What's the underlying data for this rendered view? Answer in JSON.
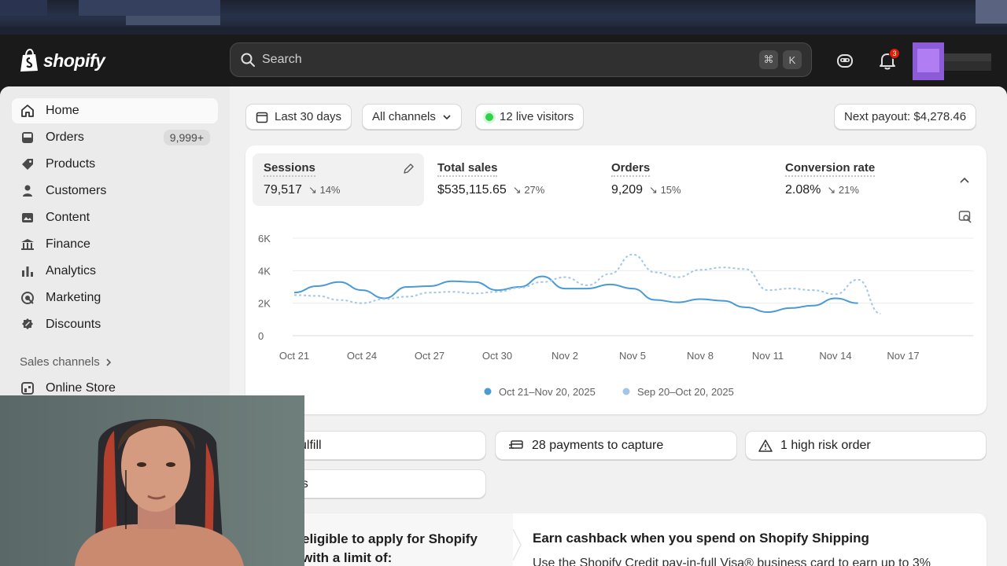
{
  "header": {
    "logo_text": "shopify",
    "search_placeholder": "Search",
    "shortcut_keys": [
      "⌘",
      "K"
    ],
    "notification_count": "3"
  },
  "sidebar": {
    "items": [
      {
        "label": "Home",
        "icon": "home-icon",
        "active": true
      },
      {
        "label": "Orders",
        "icon": "inbox-icon",
        "count": "9,999+"
      },
      {
        "label": "Products",
        "icon": "tag-icon"
      },
      {
        "label": "Customers",
        "icon": "person-icon"
      },
      {
        "label": "Content",
        "icon": "image-icon"
      },
      {
        "label": "Finance",
        "icon": "bank-icon"
      },
      {
        "label": "Analytics",
        "icon": "bar-chart-icon"
      },
      {
        "label": "Marketing",
        "icon": "target-icon"
      },
      {
        "label": "Discounts",
        "icon": "discount-icon"
      }
    ],
    "sales_channels_label": "Sales channels",
    "online_store_label": "Online Store"
  },
  "filters": {
    "date_range": "Last 30 days",
    "channels": "All channels",
    "live_visitors": "12 live visitors",
    "next_payout": "Next payout: $4,278.46"
  },
  "metrics": [
    {
      "label": "Sessions",
      "value": "79,517",
      "delta": "14%"
    },
    {
      "label": "Total sales",
      "value": "$535,115.65",
      "delta": "27%"
    },
    {
      "label": "Orders",
      "value": "9,209",
      "delta": "15%"
    },
    {
      "label": "Conversion rate",
      "value": "2.08%",
      "delta": "21%"
    }
  ],
  "chart_data": {
    "type": "line",
    "x_ticks": [
      "Oct 21",
      "Oct 24",
      "Oct 27",
      "Oct 30",
      "Nov 2",
      "Nov 5",
      "Nov 8",
      "Nov 11",
      "Nov 14",
      "Nov 17"
    ],
    "y_ticks": [
      "0",
      "2K",
      "4K",
      "6K"
    ],
    "ylim": [
      0,
      6000
    ],
    "legend_placement": "bottom",
    "series": [
      {
        "name": "Oct 21–Nov 20, 2025",
        "color": "#4a9ad4",
        "dashed": false,
        "values": [
          2650,
          3050,
          3300,
          2800,
          2300,
          3000,
          3050,
          3350,
          3300,
          2800,
          3000,
          3650,
          2900,
          2900,
          3150,
          2900,
          2200,
          2050,
          2250,
          2150,
          1750,
          1450,
          1700,
          1850,
          2300,
          2000
        ]
      },
      {
        "name": "Sep 20–Oct 20, 2025",
        "color": "#a3c6e8",
        "dashed": true,
        "values": [
          2500,
          2450,
          2200,
          2000,
          2250,
          2400,
          2650,
          2700,
          2600,
          2700,
          2950,
          3300,
          3600,
          3100,
          3800,
          5000,
          3900,
          3600,
          4050,
          4200,
          4100,
          2800,
          2900,
          2800,
          2550,
          3450,
          1350
        ]
      }
    ]
  },
  "tasks": [
    {
      "label": "orders to fulfill",
      "icon": "order-icon"
    },
    {
      "label": "28 payments to capture",
      "icon": "payment-icon"
    },
    {
      "label": "1 high risk order",
      "icon": "warning-icon"
    },
    {
      "label": "hargebacks",
      "icon": "chargeback-icon"
    }
  ],
  "promo": {
    "left_text": "eligible to apply for Shopify with a limit of:",
    "title": "Earn cashback when you spend on Shopify Shipping",
    "body": "Use the Shopify Credit pay-in-full Visa® business card to earn up to 3%"
  },
  "colors": {
    "accent_line": "#4a9ad4",
    "comparison_line": "#a3c6e8",
    "live": "#2fd34a"
  }
}
